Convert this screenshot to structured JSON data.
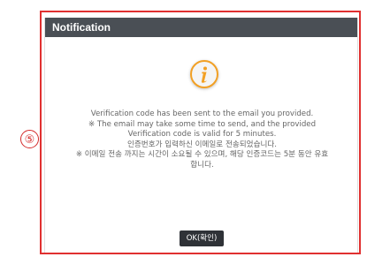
{
  "step_marker": "⑤",
  "dialog": {
    "title": "Notification",
    "icon": "info-icon",
    "icon_color": "#f2a024",
    "header_color": "#4a4f55",
    "message_lines": [
      "Verification code has been sent to the email you provided.",
      "※ The email may take some time to send, and the provided",
      "Verification code is valid for 5 minutes.",
      "인증번호가 입력하신 이메일로 전송되었습니다.",
      "※ 이메일 전송 까지는 시간이 소요될 수 있으며, 해당 인증코드는 5분 동안 유효",
      "합니다."
    ],
    "ok_label": "OK(확인)"
  },
  "highlight_color": "#e03030"
}
